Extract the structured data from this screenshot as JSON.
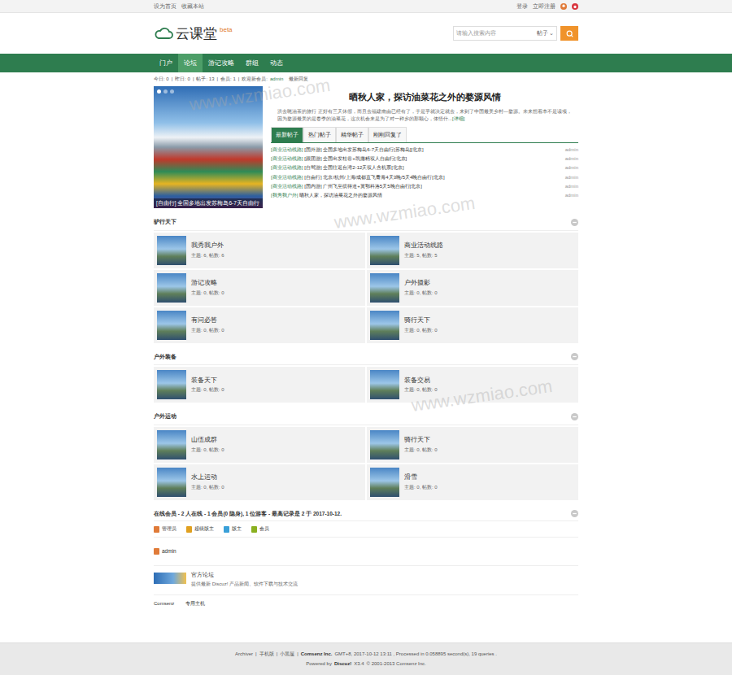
{
  "top_bar": {
    "left_links": [
      "设为首页",
      "收藏本站"
    ],
    "right_links": [
      "登录",
      "立即注册"
    ]
  },
  "logo": {
    "name": "云课堂",
    "badge": "beta"
  },
  "search": {
    "placeholder": "请输入搜索内容",
    "scope": "帖子",
    "scope_arrow": "⌄"
  },
  "nav": [
    {
      "label": "门户",
      "selected": false
    },
    {
      "label": "论坛",
      "selected": true
    },
    {
      "label": "游记攻略",
      "selected": false
    },
    {
      "label": "群组",
      "selected": false
    },
    {
      "label": "动态",
      "selected": false
    }
  ],
  "stats": {
    "items": [
      "今日: 0",
      "昨日: 0",
      "帖子: 13",
      "会员: 1"
    ],
    "separator": "|",
    "welcome": "欢迎新会员:",
    "member": "admin",
    "latest": "最新回复"
  },
  "slider": {
    "caption": "[自由行] 全国多地出发苏梅岛6-7天自由行",
    "dots": [
      {
        "selected": true
      },
      {
        "selected": false
      },
      {
        "selected": false
      }
    ]
  },
  "headline": {
    "title": "晒秋人家，探访油菜花之外的婺源风情",
    "description": "洪去晓油茶的旅行 正好有三天休假，而且去福建南由已经有了，于是乎就决定就去，来到了中国最美乡村—婺源。未来想着本不是读项，因为婺源最美的是春季的油菜花，这次机会来是为了对一种乡的那颗心，体悟什...",
    "more": "[详细]"
  },
  "tabs": [
    {
      "label": "最新帖子",
      "selected": true
    },
    {
      "label": "热门帖子",
      "selected": false
    },
    {
      "label": "精华帖子",
      "selected": false
    },
    {
      "label": "刚刚回复了",
      "selected": false
    }
  ],
  "threads": [
    {
      "category": "[商业活动线路]",
      "title": "[国外游] 全国多地出发苏梅岛6-7天自由行[苏梅岛][北京]",
      "author": "admin"
    },
    {
      "category": "[商业活动线路]",
      "title": "[跟团游] 全国出发桂谷+凯撒精双人自由行[北京]",
      "author": "admin"
    },
    {
      "category": "[商业活动线路]",
      "title": "[自驾游] 全国往返台湾2-12天双人含机票[北京]",
      "author": "admin"
    },
    {
      "category": "[商业活动线路]",
      "title": "[自由行] 北京/杭州/上海/成都直飞青海4天3晚/5天4晚自由行[北京]",
      "author": "admin"
    },
    {
      "category": "[商业活动线路]",
      "title": "[国内游] 广州飞至缤得道+翼鄂科洛5天5晚自由行[北京]",
      "author": "admin"
    },
    {
      "category": "[我秀我户外]",
      "title": "晒秋人家，探访油菜花之外的婺源风情",
      "author": "admin"
    }
  ],
  "sections": [
    {
      "title": "驴行天下",
      "forums": [
        {
          "name": "我秀我户外",
          "stats": "主题: 6, 帖数: 6"
        },
        {
          "name": "商业活动线路",
          "stats": "主题: 5, 帖数: 5"
        },
        {
          "name": "游记攻略",
          "stats": "主题: 0, 帖数: 0"
        },
        {
          "name": "户外摄影",
          "stats": "主题: 0, 帖数: 0"
        },
        {
          "name": "有问必答",
          "stats": "主题: 0, 帖数: 0"
        },
        {
          "name": "骑行天下",
          "stats": "主题: 0, 帖数: 0"
        }
      ]
    },
    {
      "title": "户外装备",
      "forums": [
        {
          "name": "装备天下",
          "stats": "主题: 0, 帖数: 0"
        },
        {
          "name": "装备交易",
          "stats": "主题: 0, 帖数: 0"
        }
      ]
    },
    {
      "title": "户外运动",
      "forums": [
        {
          "name": "山伍成群",
          "stats": "主题: 0, 帖数: 0"
        },
        {
          "name": "骑行天下",
          "stats": "主题: 0, 帖数: 0"
        },
        {
          "name": "水上运动",
          "stats": "主题: 0, 帖数: 0"
        },
        {
          "name": "滑雪",
          "stats": "主题: 0, 帖数: 0"
        }
      ]
    }
  ],
  "online": {
    "title": "在线会员 - 2 人在线 - 1 会员(0 隐身), 1 位游客 - 最高记录是 2 于 2017-10-12.",
    "legend": [
      {
        "label": "管理员",
        "color": "#e07b39"
      },
      {
        "label": "超级版主",
        "color": "#e0a020"
      },
      {
        "label": "版主",
        "color": "#3aa0d8"
      },
      {
        "label": "会员",
        "color": "#8ab020"
      }
    ],
    "members": [
      {
        "name": "admin",
        "color": "#e07b39"
      }
    ]
  },
  "links": {
    "featured": {
      "title": "官方论坛",
      "description": "提供最新 Discuz! 产品新闻、软件下载与技术交流"
    },
    "text_links": [
      "Comsenz",
      "专用主机"
    ]
  },
  "footer": {
    "links": [
      "Archiver",
      "手机版",
      "小黑屋"
    ],
    "separator": "|",
    "company": "Comsenz Inc.",
    "info": "GMT+8, 2017-10-12 13:11 , Processed in 0.058895 second(s), 19 queries .",
    "powered_prefix": "Powered by",
    "brand": "Discuz!",
    "version": "X3.4",
    "copyright": "© 2001-2013 Comsenz Inc."
  },
  "watermarks": [
    "www.wzmiao.com",
    "www.wzmiao.com",
    "www.wzmiao.com"
  ]
}
